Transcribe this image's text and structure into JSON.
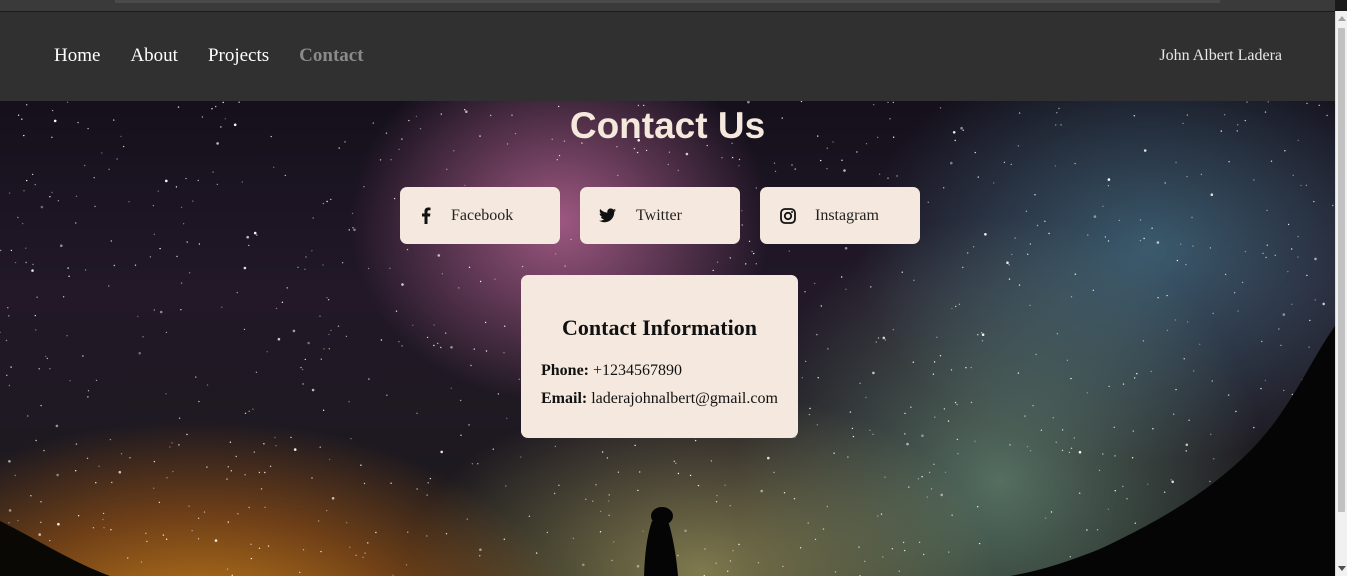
{
  "nav": {
    "links": [
      "Home",
      "About",
      "Projects",
      "Contact"
    ],
    "active": "Contact",
    "brand": "John Albert Ladera"
  },
  "hero": {
    "title": "Contact Us",
    "social": [
      {
        "label": "Facebook",
        "icon": "facebook-icon"
      },
      {
        "label": "Twitter",
        "icon": "twitter-icon"
      },
      {
        "label": "Instagram",
        "icon": "instagram-icon"
      }
    ]
  },
  "contact": {
    "heading": "Contact Information",
    "phone_label": "Phone:",
    "phone": "+1234567890",
    "email_label": "Email:",
    "email": "laderajohnalbert@gmail.com"
  },
  "colors": {
    "navbar": "#303030",
    "card": "#f5e9df",
    "title": "#f5e8dc",
    "active_link": "#8a8a8a"
  }
}
